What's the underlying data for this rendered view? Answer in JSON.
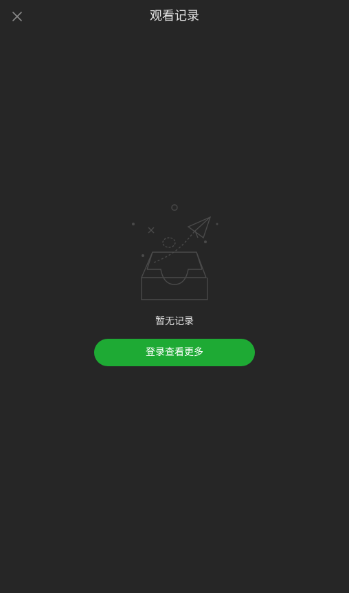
{
  "header": {
    "title": "观看记录",
    "close_icon": "close-icon"
  },
  "empty_state": {
    "illustration_icon": "empty-tray-paper-plane-icon",
    "message": "暂无记录"
  },
  "actions": {
    "login_label": "登录查看更多"
  },
  "colors": {
    "background": "#262626",
    "accent": "#1eaa34",
    "text": "#e6e6e6"
  }
}
